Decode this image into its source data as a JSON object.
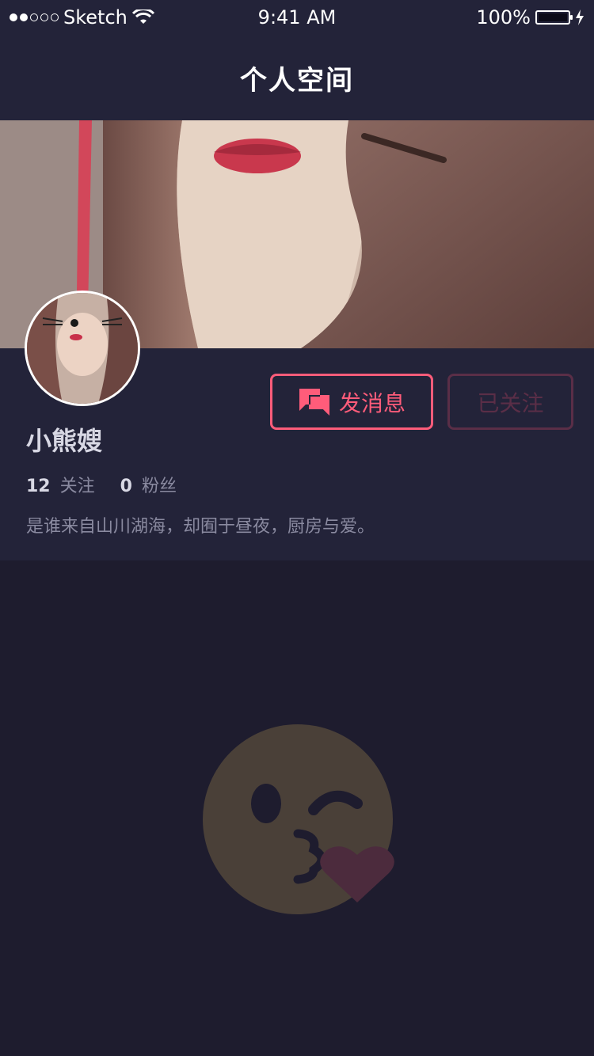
{
  "status_bar": {
    "carrier": "Sketch",
    "time": "9:41 AM",
    "battery": "100%"
  },
  "nav": {
    "title": "个人空间"
  },
  "profile": {
    "name": "小熊嫂",
    "following_count": "12",
    "following_label": "关注",
    "followers_count": "0",
    "followers_label": "粉丝",
    "bio": "是谁来自山川湖海，却囿于昼夜，厨房与爱。"
  },
  "actions": {
    "message_label": "发消息",
    "follow_label": "已关注"
  },
  "colors": {
    "accent": "#ff5c7a",
    "muted_accent": "#5a2e47",
    "panel": "#232339",
    "background": "#1e1c2e",
    "empty_face": "#4a4038",
    "empty_heart": "#4c2b3d"
  },
  "icons": {
    "message": "chat-bubbles-icon",
    "empty": "kiss-emoji-icon"
  }
}
